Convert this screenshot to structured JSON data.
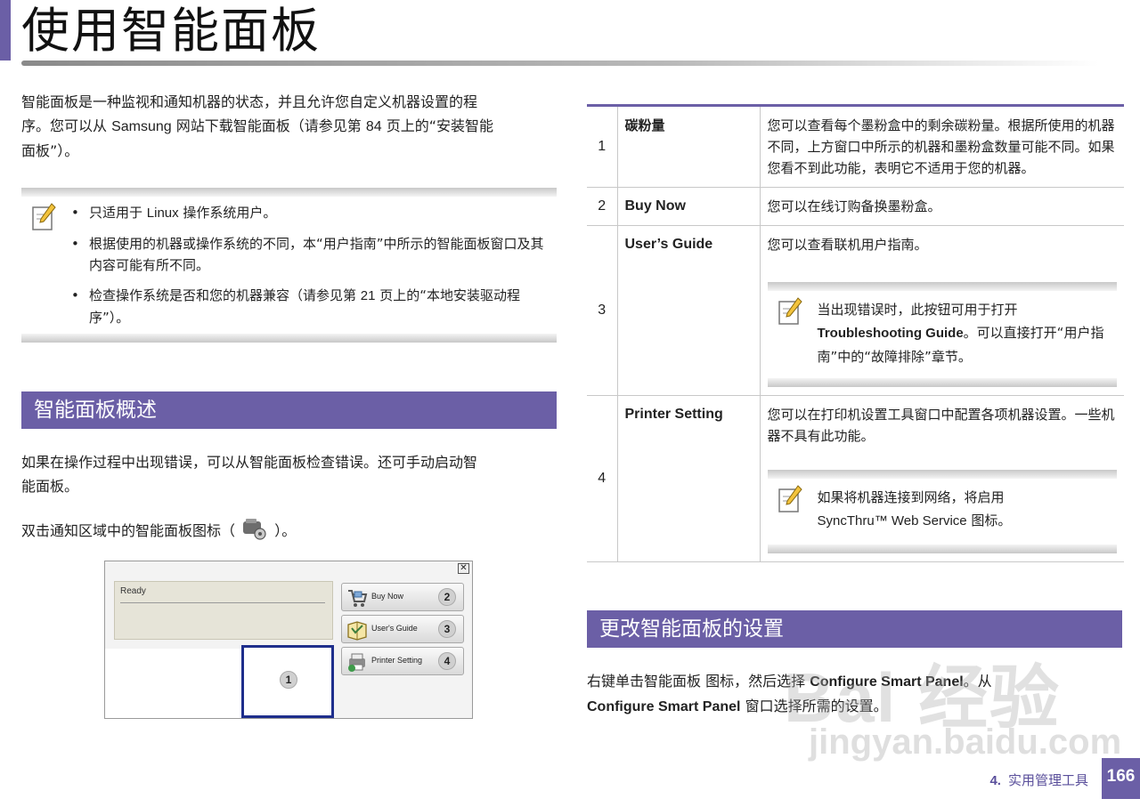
{
  "page": {
    "title": "使用智能面板"
  },
  "intro": {
    "line1": "智能面板是一种监视和通知机器的状态，并且允许您自定义机器设置的程",
    "line2_pre": "序。您可以从 ",
    "line2_brand": "Samsung",
    "line2_mid": " 网站下载智能面板（请参见第 ",
    "line2_page": "84",
    "line2_post": " 页上的“安装智能",
    "line3": "面板”）。"
  },
  "note1": {
    "icon": "pencil-note-icon",
    "items": [
      {
        "pre": "只适用于 ",
        "em": "Linux",
        "post": " 操作系统用户。"
      },
      {
        "pre": "根据使用的机器或操作系统的不同，本“用户指南”中所示的智能面板窗口及其内容可能有所不同。",
        "em": "",
        "post": ""
      },
      {
        "pre": "检查操作系统是否和您的机器兼容（请参见第 ",
        "em": "21",
        "post": " 页上的“本地安装驱动程序”）。"
      }
    ]
  },
  "overview": {
    "header": "智能面板概述",
    "para1_line1": "如果在操作过程中出现错误，可以从智能面板检查错误。还可手动启动智",
    "para1_line2": "能面板。",
    "para2_pre": "双击通知区域中的智能面板图标（",
    "para2_post": "）。",
    "tray_icon": "smart-panel-tray-icon"
  },
  "screenshot": {
    "close": "✕",
    "status": "Ready",
    "selected_num": "1",
    "buttons": [
      {
        "label": "Buy Now",
        "num": "2",
        "icon": "cart-icon"
      },
      {
        "label": "User's Guide",
        "num": "3",
        "icon": "guide-book-icon"
      },
      {
        "label": "Printer Setting",
        "num": "4",
        "icon": "printer-icon"
      }
    ]
  },
  "table": {
    "rows": [
      {
        "num": "1",
        "name": "碳粉量",
        "desc": "您可以查看每个墨粉盒中的剩余碳粉量。根据所使用的机器不同，上方窗口中所示的机器和墨粉盒数量可能不同。如果您看不到此功能，表明它不适用于您的机器。"
      },
      {
        "num": "2",
        "name": "Buy Now",
        "desc": "您可以在线订购备换墨粉盒。"
      },
      {
        "num": "3",
        "name": "User’s Guide",
        "desc": "您可以查看联机用户指南。",
        "note_pre": "当出现错误时，此按钮可用于打开 ",
        "note_bold": "Troubleshooting Guide",
        "note_post": "。可以直接打开“用户指南”中的“故障排除”章节。"
      },
      {
        "num": "4",
        "name": "Printer Setting",
        "desc": "您可以在打印机设置工具窗口中配置各项机器设置。一些机器不具有此功能。",
        "note_pre": "如果将机器连接到网络，将启用 ",
        "note_bold": "",
        "note_en": "SyncThru™ Web Service",
        "note_post": " 图标。"
      }
    ]
  },
  "change": {
    "header": "更改智能面板的设置",
    "line1_pre": "右键单击智能面板 图标，然后选择 ",
    "line1_bold": "Configure Smart Panel",
    "line1_post": "。从",
    "line2_bold": "Configure Smart Panel",
    "line2_post": " 窗口选择所需的设置。"
  },
  "footer": {
    "chapter_num": "4.",
    "chapter_title": "实用管理工具",
    "page_number": "166"
  },
  "watermark": {
    "logo_text": "Bai 经验",
    "url": "jingyan.baidu.com"
  }
}
